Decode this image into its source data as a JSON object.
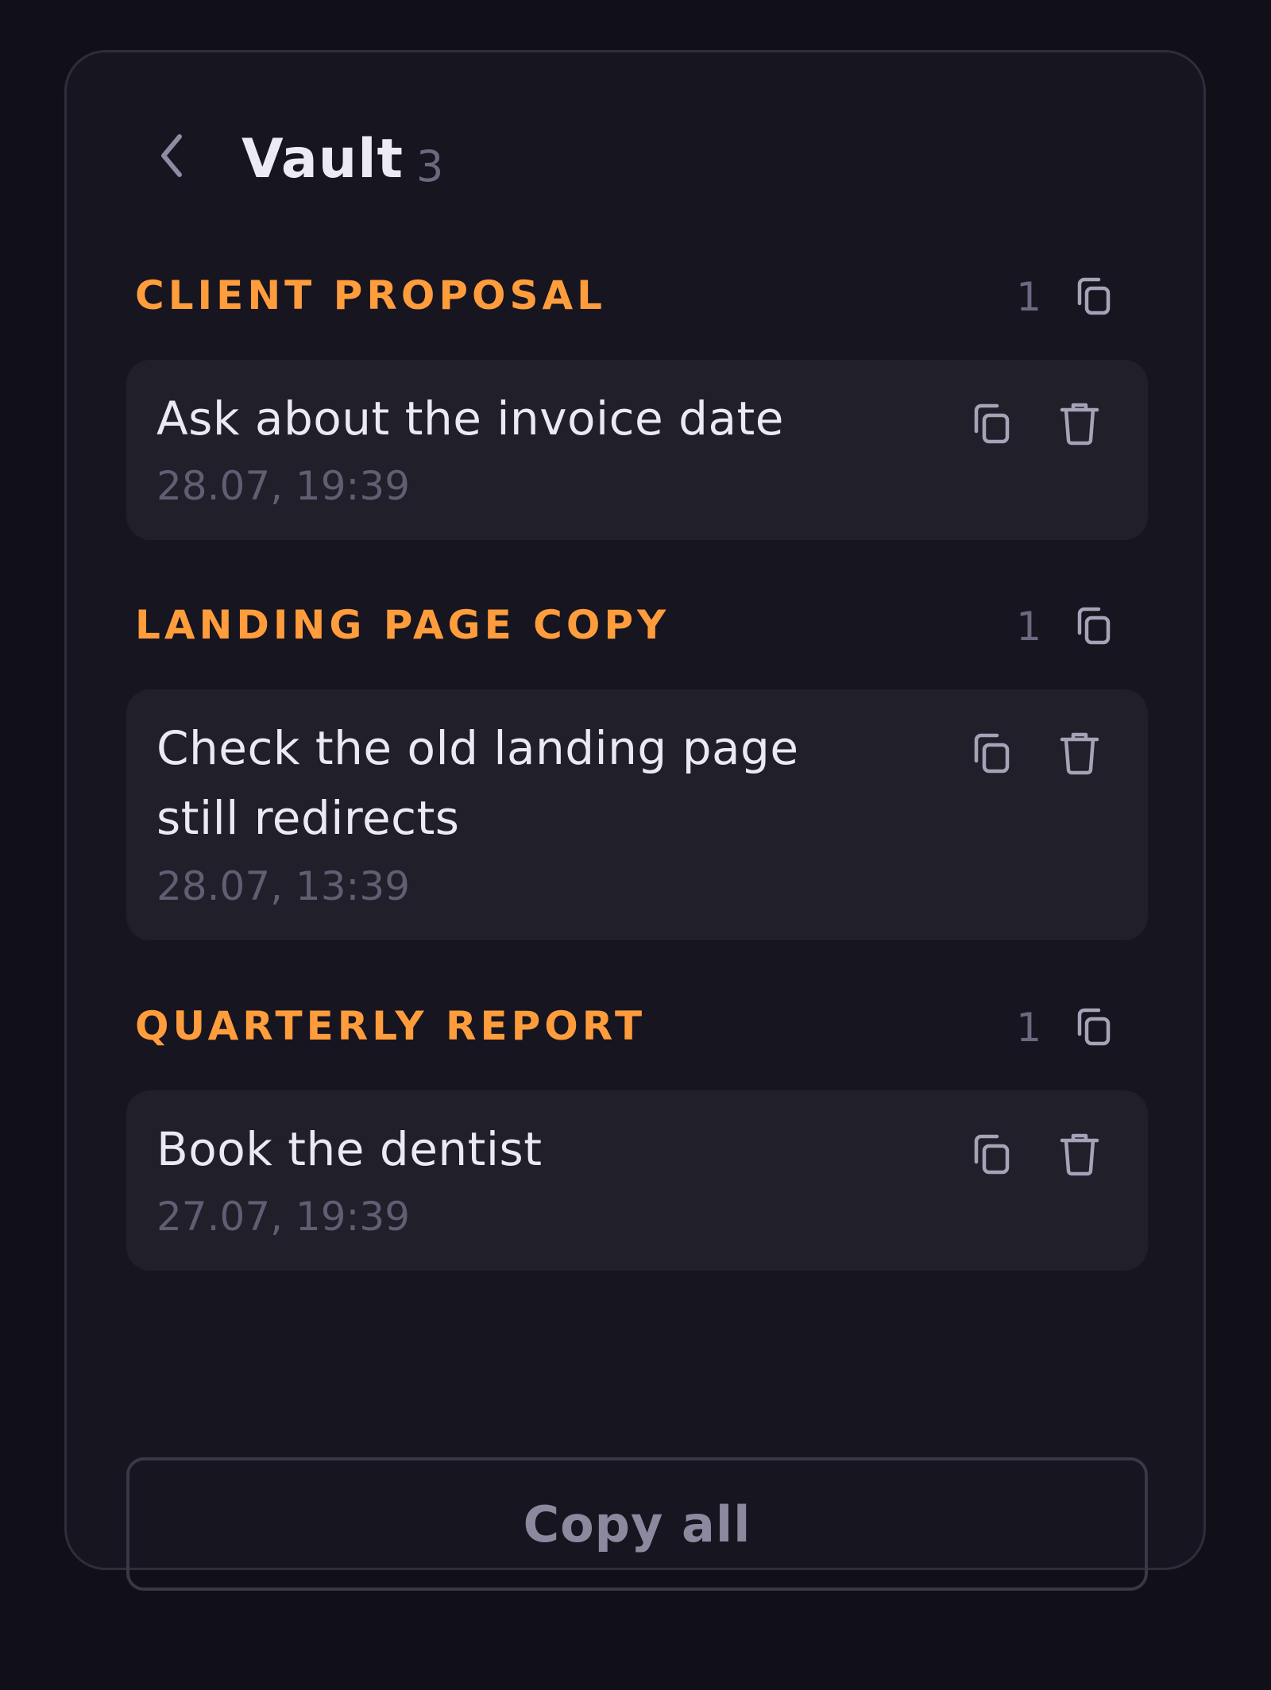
{
  "header": {
    "back_icon": "chevron-left-icon",
    "title": "Vault",
    "count": "3"
  },
  "sections": [
    {
      "title": "CLIENT PROPOSAL",
      "count": "1",
      "items": [
        {
          "text": "Ask about the invoice date",
          "time": "28.07, 19:39"
        }
      ]
    },
    {
      "title": "LANDING PAGE COPY",
      "count": "1",
      "items": [
        {
          "text": "Check the old landing page still redirects",
          "time": "28.07, 13:39"
        }
      ]
    },
    {
      "title": "QUARTERLY REPORT",
      "count": "1",
      "items": [
        {
          "text": "Book the dentist",
          "time": "27.07, 19:39"
        }
      ]
    }
  ],
  "footer": {
    "copy_all_label": "Copy all"
  },
  "colors": {
    "background": "#111018",
    "panel": "#17151f",
    "card": "#211f2a",
    "accent": "#ff9d3d",
    "text": "#ebe9f1",
    "muted": "#6c6880"
  }
}
